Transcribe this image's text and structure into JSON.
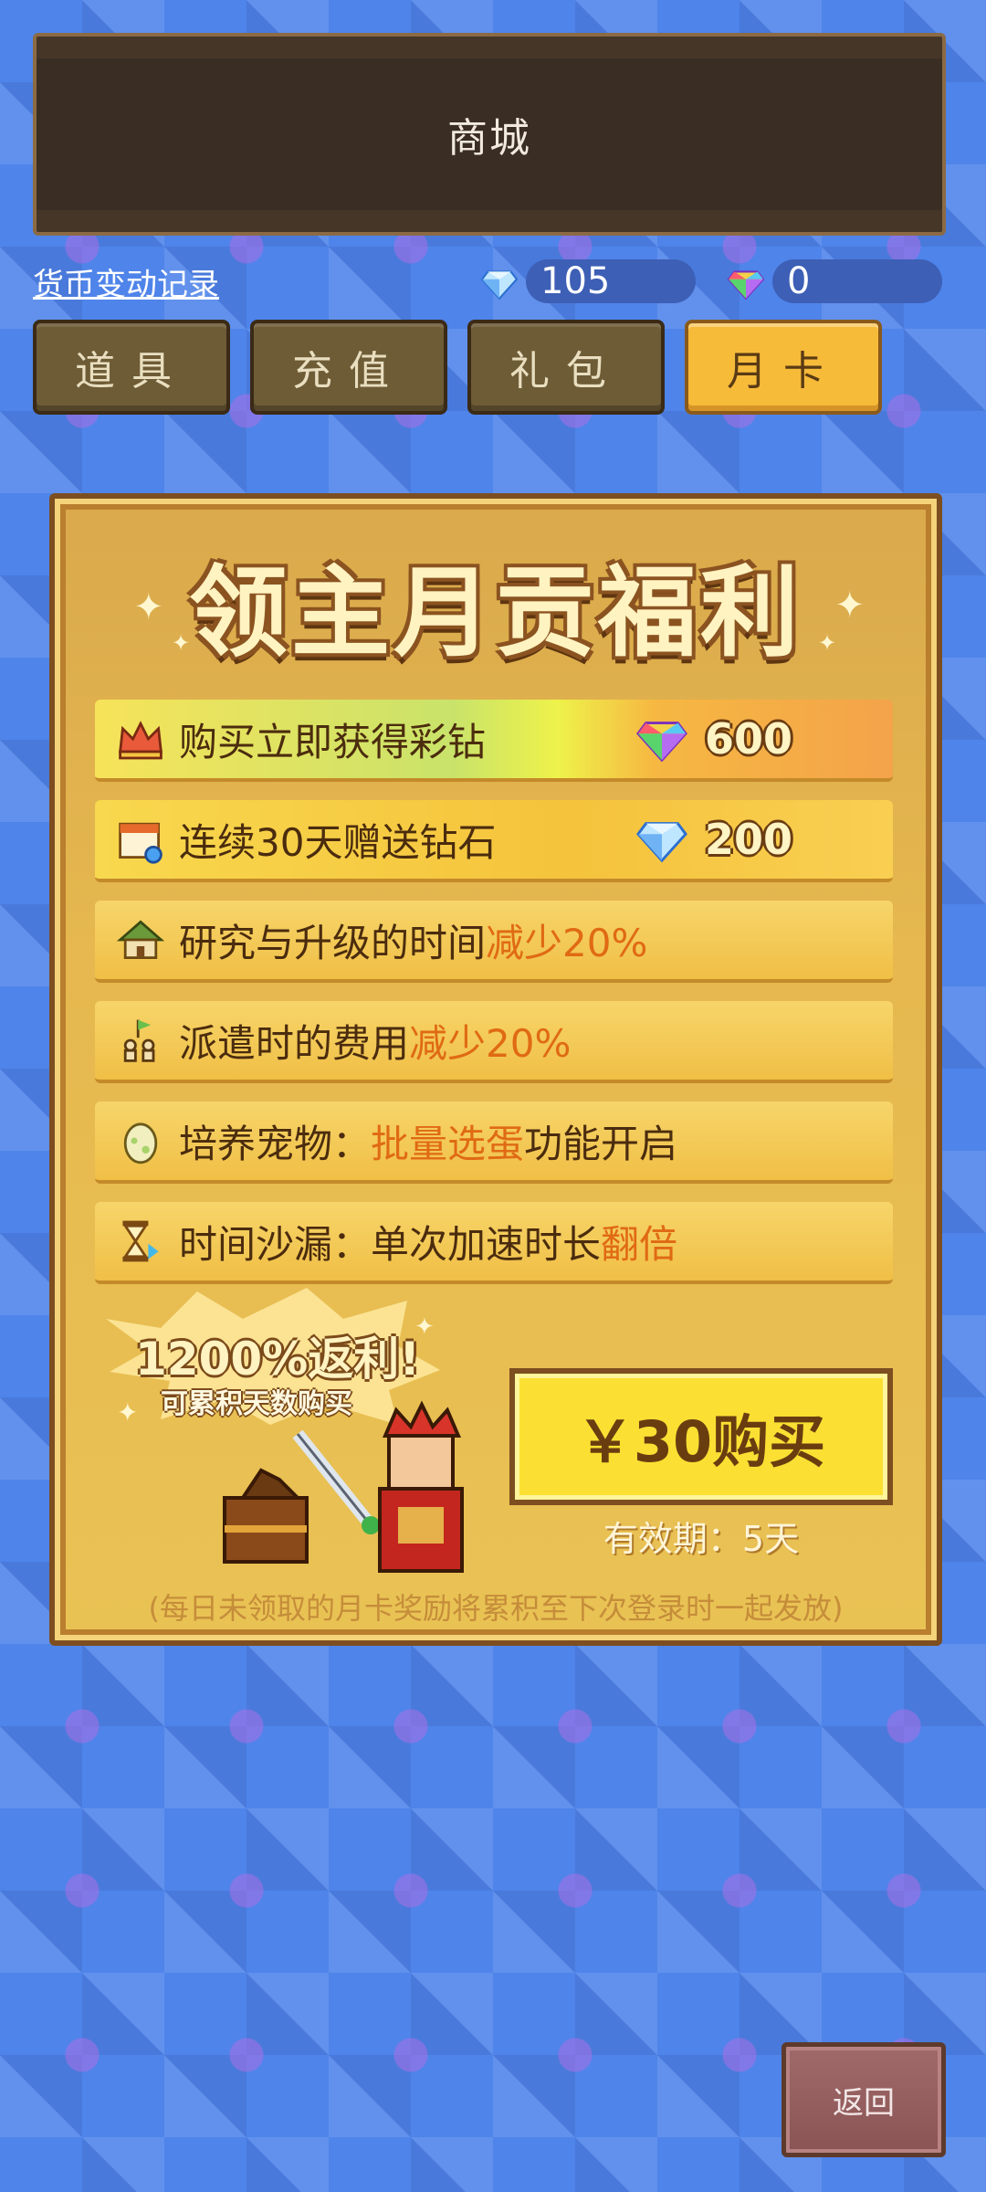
{
  "header": {
    "title": "商城"
  },
  "top": {
    "history_link": "货币变动记录",
    "diamond_count": "105",
    "rainbow_count": "0"
  },
  "tabs": [
    {
      "label": "道具"
    },
    {
      "label": "充值"
    },
    {
      "label": "礼包"
    },
    {
      "label": "月卡",
      "active": true
    }
  ],
  "card": {
    "banner": "领主月贡福利",
    "rows": [
      {
        "text": "购买立即获得彩钻",
        "value": "600",
        "icon": "crown-icon",
        "value_icon": "rainbow-diamond-icon"
      },
      {
        "text": "连续30天赠送钻石",
        "value": "200",
        "icon": "calendar-icon",
        "value_icon": "diamond-icon"
      },
      {
        "text": "研究与升级的时间",
        "highlight": "减少20%",
        "icon": "house-icon"
      },
      {
        "text": "派遣时的费用",
        "highlight": "减少20%",
        "icon": "flag-people-icon"
      },
      {
        "text": "培养宠物：",
        "highlight": "批量选蛋",
        "suffix": "功能开启",
        "icon": "egg-icon"
      },
      {
        "text": "时间沙漏：单次加速时长",
        "highlight": "翻倍",
        "icon": "hourglass-icon"
      }
    ],
    "promo_main": "1200%返利!",
    "promo_sub": "可累积天数购买",
    "buy_button": "￥30购买",
    "validity": "有效期：5天",
    "footnote": "(每日未领取的月卡奖励将累积至下次登录时一起发放)"
  },
  "back_button": "返回",
  "colors": {
    "active_tab": "#f7bb3a",
    "highlight": "#e06a14",
    "buy_button": "#fbe033"
  }
}
